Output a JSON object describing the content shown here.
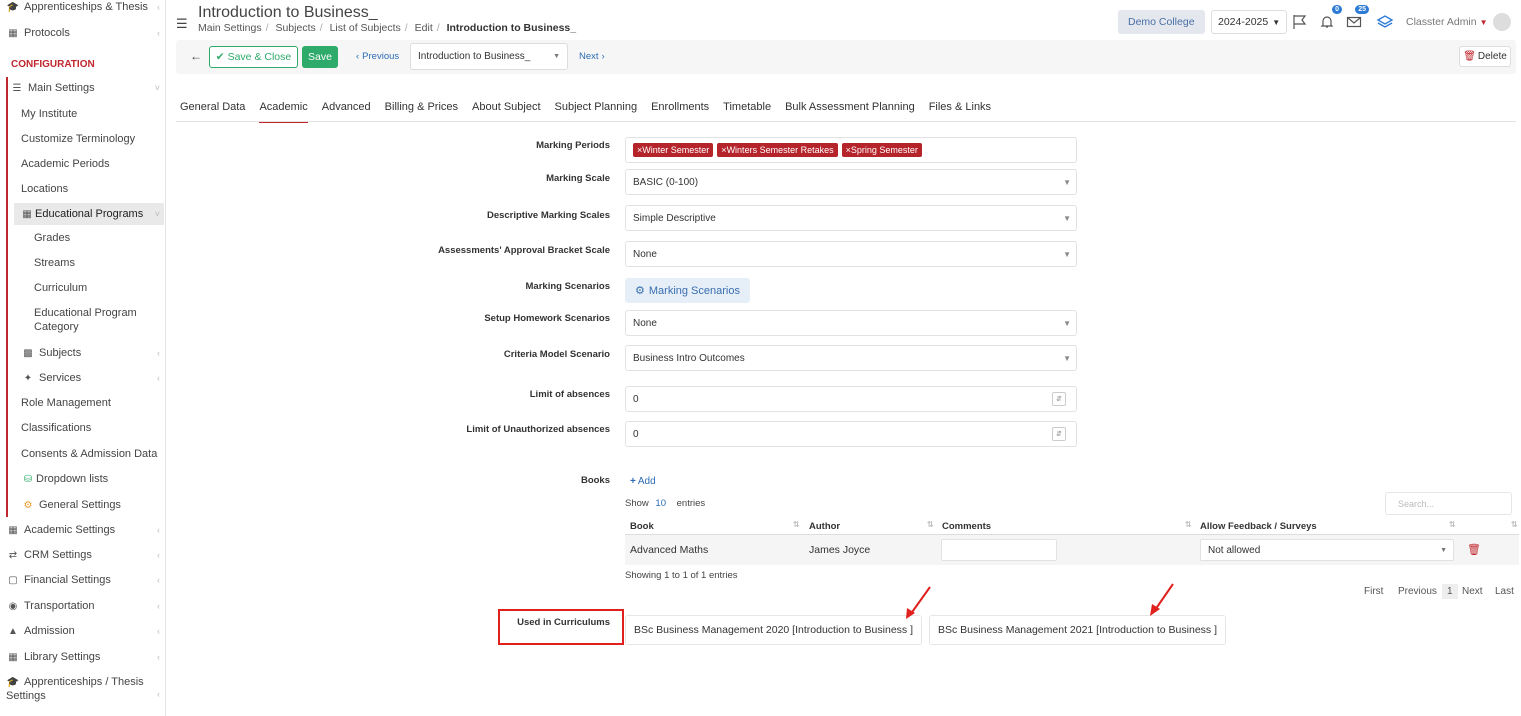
{
  "sidebar": {
    "top_items": [
      {
        "label": "Apprenticeships & Thesis",
        "icon": "graduation-icon"
      },
      {
        "label": "Protocols",
        "icon": "protocols-icon"
      }
    ],
    "config_heading": "CONFIGURATION",
    "main_settings": "Main Settings",
    "sub_items": [
      "My Institute",
      "Customize Terminology",
      "Academic Periods",
      "Locations"
    ],
    "edu_programs": "Educational Programs",
    "edu_sub": [
      "Grades",
      "Streams",
      "Curriculum",
      "Educational Program",
      "Category"
    ],
    "items2": [
      "Subjects",
      "Services",
      "Role Management",
      "Classifications",
      "Consents & Admission Data",
      "Dropdown lists",
      "General Settings"
    ],
    "bottom_items": [
      "Academic Settings",
      "CRM Settings",
      "Financial Settings",
      "Transportation",
      "Admission",
      "Library Settings",
      "Apprenticeships / Thesis",
      "Settings"
    ]
  },
  "header": {
    "title": "Introduction to Business_",
    "breadcrumb": [
      "Main Settings",
      "Subjects",
      "List of Subjects",
      "Edit"
    ],
    "breadcrumb_current": "Introduction to Business_",
    "college": "Demo College",
    "year": "2024-2025",
    "notif_count": "0",
    "msg_count": "25",
    "user": "Classter Admin"
  },
  "toolbar": {
    "save_close": "Save & Close",
    "save": "Save",
    "previous": "Previous",
    "subject_select": "Introduction to Business_",
    "next": "Next",
    "delete": "Delete"
  },
  "tabs": [
    "General Data",
    "Academic",
    "Advanced",
    "Billing & Prices",
    "About Subject",
    "Subject Planning",
    "Enrollments",
    "Timetable",
    "Bulk Assessment Planning",
    "Files & Links"
  ],
  "form": {
    "marking_periods_label": "Marking Periods",
    "marking_periods": [
      "Winter Semester",
      "Winters Semester Retakes",
      "Spring Semester"
    ],
    "marking_scale_label": "Marking Scale",
    "marking_scale": "BASIC (0-100)",
    "descriptive_label": "Descriptive Marking Scales",
    "descriptive": "Simple Descriptive",
    "approval_label": "Assessments' Approval Bracket Scale",
    "approval": "None",
    "scenarios_label": "Marking Scenarios",
    "scenarios_button": "Marking Scenarios",
    "homework_label": "Setup Homework Scenarios",
    "homework": "None",
    "criteria_label": "Criteria Model Scenario",
    "criteria": "Business Intro Outcomes",
    "absences_label": "Limit of absences",
    "absences": "0",
    "unauth_label": "Limit of Unauthorized absences",
    "unauth": "0"
  },
  "books": {
    "label": "Books",
    "add": "Add",
    "show": "Show",
    "entries_count": "10",
    "entries": "entries",
    "search_placeholder": "Search...",
    "headers": [
      "Book",
      "Author",
      "Comments",
      "Allow Feedback / Surveys"
    ],
    "rows": [
      {
        "book": "Advanced Maths",
        "author": "James Joyce",
        "comments": "",
        "feedback": "Not allowed"
      }
    ],
    "info": "Showing 1 to 1 of 1 entries",
    "pagination": [
      "First",
      "Previous",
      "1",
      "Next",
      "Last"
    ]
  },
  "curriculums": {
    "label": "Used in Curriculums",
    "items": [
      "BSc Business Management 2020 [Introduction to Business ]",
      "BSc Business Management 2021 [Introduction to Business ]"
    ]
  },
  "colors": {
    "accent": "#c0262d",
    "green": "#2eaa6a",
    "blue": "#2d7bd6",
    "annotation": "#e0201c"
  }
}
